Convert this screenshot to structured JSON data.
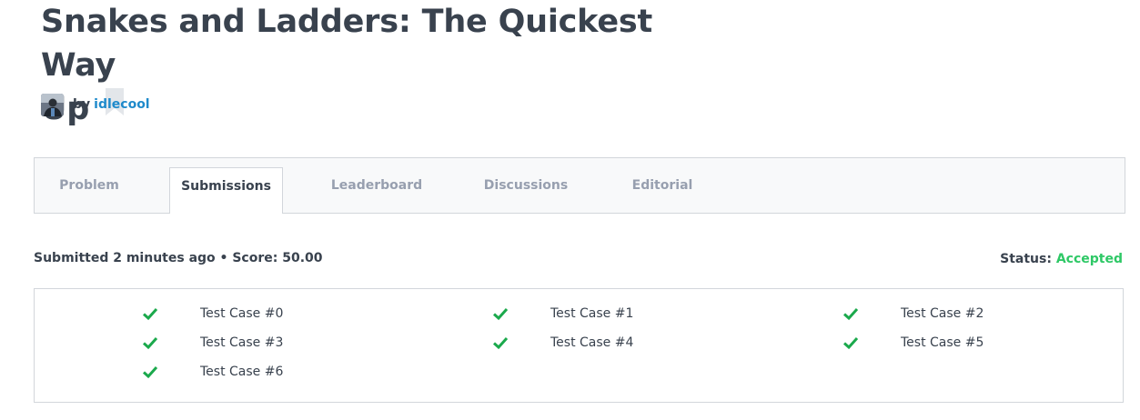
{
  "challenge": {
    "title_line1": "Snakes and Ladders: The Quickest Way",
    "title_line2": "Up",
    "author_prefix": "by",
    "author_name": "idlecool"
  },
  "tabs": [
    {
      "label": "Problem",
      "active": false
    },
    {
      "label": "Submissions",
      "active": true
    },
    {
      "label": "Leaderboard",
      "active": false
    },
    {
      "label": "Discussions",
      "active": false
    },
    {
      "label": "Editorial",
      "active": false
    }
  ],
  "submission": {
    "summary": "Submitted 2 minutes ago • Score: 50.00",
    "status_label": "Status:",
    "status_value": "Accepted"
  },
  "test_cases": [
    {
      "label": "Test Case #0",
      "passed": true
    },
    {
      "label": "Test Case #1",
      "passed": true
    },
    {
      "label": "Test Case #2",
      "passed": true
    },
    {
      "label": "Test Case #3",
      "passed": true
    },
    {
      "label": "Test Case #4",
      "passed": true
    },
    {
      "label": "Test Case #5",
      "passed": true
    },
    {
      "label": "Test Case #6",
      "passed": true
    }
  ],
  "colors": {
    "accent_link": "#1f8acb",
    "accepted": "#2ec866",
    "check": "#1ba94c"
  },
  "icons": {
    "bookmark": "bookmark-icon",
    "check": "check-icon"
  }
}
